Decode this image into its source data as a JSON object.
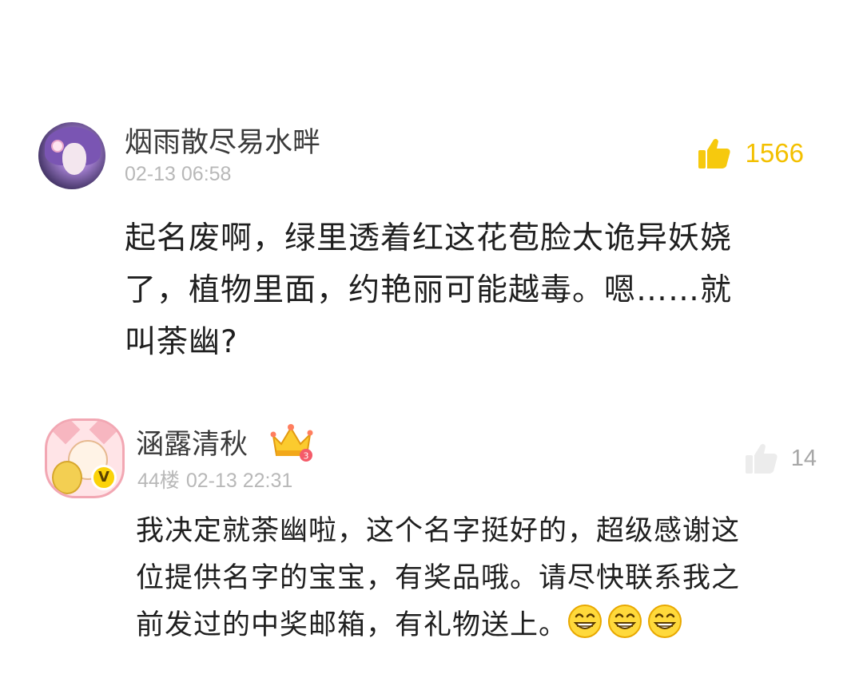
{
  "comments": [
    {
      "username": "烟雨散尽易水畔",
      "timestamp": "02-13 06:58",
      "like_count": "1566",
      "liked": true,
      "text": "起名废啊，绿里透着红这花苞脸太诡异妖娆\n了，植物里面，约艳丽可能越毒。嗯……就\n叫荼幽?"
    },
    {
      "username": "涵露清秋",
      "badge_level": "3",
      "verified_label": "V",
      "floor": "44楼",
      "timestamp": "02-13 22:31",
      "like_count": "14",
      "liked": false,
      "text": "我决定就荼幽啦，这个名字挺好的，超级感谢这\n位提供名字的宝宝，有奖品哦。请尽快联系我之\n前发过的中奖邮箱，有礼物送上。",
      "emojis": [
        "grin-emoji",
        "grin-emoji",
        "grin-emoji"
      ]
    }
  ],
  "colors": {
    "like_active": "#F3C000",
    "like_inactive": "#A7A7A7",
    "meta_text": "#B8B8B8",
    "username": "#3A3A3A"
  }
}
